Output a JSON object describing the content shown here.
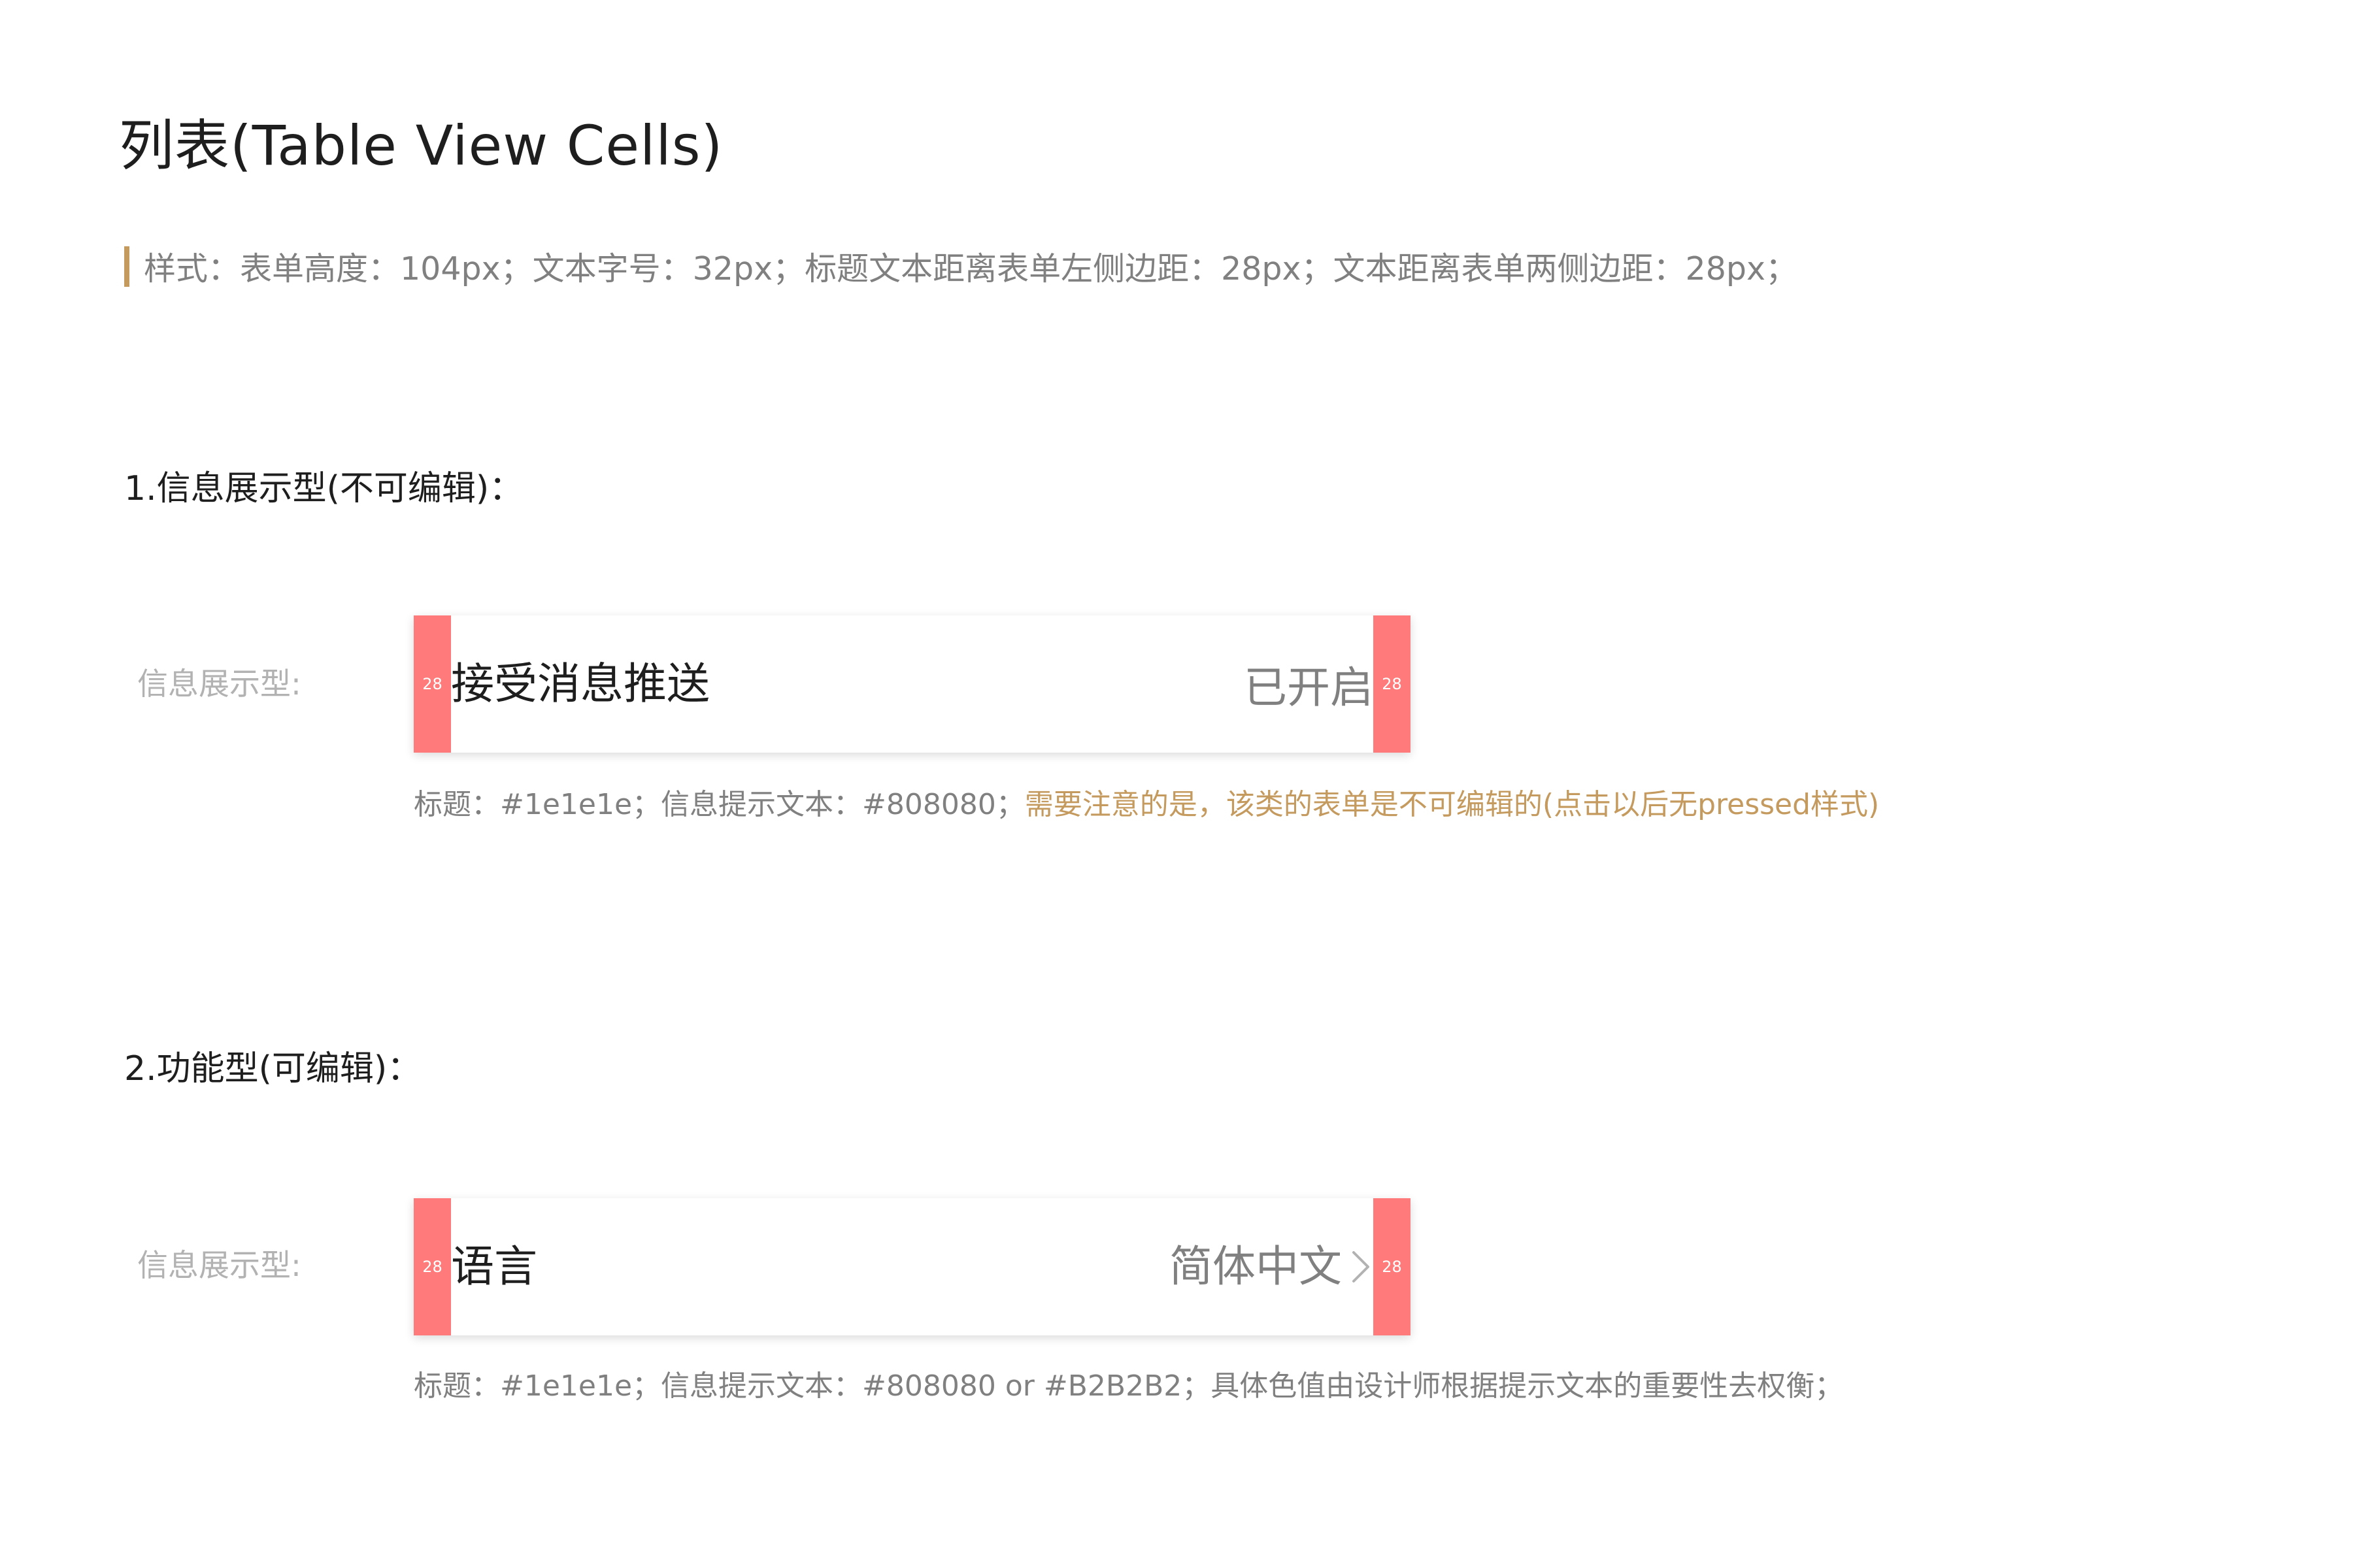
{
  "page": {
    "title": "列表(Table View Cells)",
    "spec": "样式：表单高度：104px；文本字号：32px；标题文本距离表单左侧边距：28px；文本距离表单两侧边距：28px；"
  },
  "sections": [
    {
      "heading": "1.信息展示型(不可编辑)：",
      "row_label": "信息展示型:",
      "padding_marker": "28",
      "cell": {
        "title": "接受消息推送",
        "value": "已开启",
        "has_chevron": false
      },
      "note": "标题：#1e1e1e；信息提示文本：#808080；",
      "note_warning": "需要注意的是，该类的表单是不可编辑的(点击以后无pressed样式)"
    },
    {
      "heading": "2.功能型(可编辑)：",
      "row_label": "信息展示型:",
      "padding_marker": "28",
      "cell": {
        "title": "语言",
        "value": "简体中文",
        "has_chevron": true,
        "chevron_icon": "chevron-right-icon"
      },
      "note": "标题：#1e1e1e；信息提示文本：#808080 or #B2B2B2；具体色值由设计师根据提示文本的重要性去权衡；",
      "note_warning": ""
    }
  ],
  "colors": {
    "title_text": "#1e1e1e",
    "info_text": "#808080",
    "secondary_text": "#B2B2B2",
    "accent_bar": "#c49a5e",
    "padding_marker": "#ff7b7b"
  }
}
